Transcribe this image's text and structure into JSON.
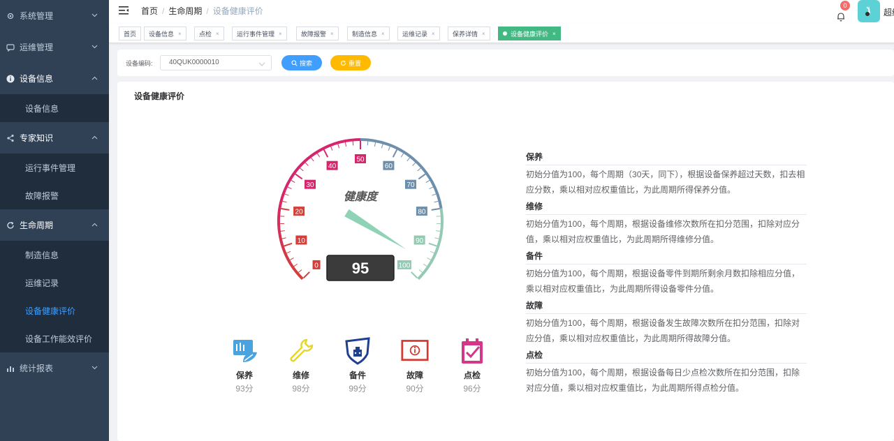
{
  "sidebar": {
    "items": [
      {
        "label": "系统管理",
        "icon": "gear-icon",
        "open": false
      },
      {
        "label": "运维管理",
        "icon": "chat-icon",
        "open": false
      },
      {
        "label": "设备信息",
        "icon": "info-icon",
        "open": true,
        "children": [
          "设备信息"
        ]
      },
      {
        "label": "专家知识",
        "icon": "share-icon",
        "open": true,
        "children": [
          "运行事件管理",
          "故障报警"
        ]
      },
      {
        "label": "生命周期",
        "icon": "refresh-icon",
        "open": true,
        "children": [
          "制造信息",
          "运维记录",
          "设备健康评价",
          "设备工作能效评价"
        ]
      },
      {
        "label": "统计报表",
        "icon": "bar-chart-icon",
        "open": false
      }
    ],
    "active_child": "设备健康评价"
  },
  "header": {
    "breadcrumb": [
      "首页",
      "生命周期",
      "设备健康评价"
    ],
    "badge_count": "0",
    "username": "超级"
  },
  "tags": [
    "首页",
    "设备信息",
    "点检",
    "运行事件管理",
    "故障报警",
    "制造信息",
    "运维记录",
    "保养详情",
    "设备健康评价"
  ],
  "active_tag": "设备健康评价",
  "search": {
    "label": "设备编码:",
    "value": "40QUK0000010",
    "search_btn": "搜索",
    "reset_btn": "重置"
  },
  "card": {
    "title": "设备健康评价"
  },
  "gauge": {
    "title": "健康度",
    "value": 95,
    "min": 0,
    "max": 100,
    "tick_labels": [
      "0",
      "10",
      "20",
      "30",
      "40",
      "50",
      "60",
      "70",
      "80",
      "90",
      "100"
    ],
    "colors": {
      "low": "#d43f3a",
      "mid": "#d6256d",
      "high": "#6e8fab",
      "top": "#94c9b4"
    }
  },
  "categories": [
    {
      "name": "保养",
      "score": "93分",
      "icon": "leaf-document-icon",
      "color": "#4aa3df"
    },
    {
      "name": "维修",
      "score": "98分",
      "icon": "wrench-icon",
      "color": "#e3d630"
    },
    {
      "name": "备件",
      "score": "99分",
      "icon": "parts-icon",
      "color": "#1f3f8f"
    },
    {
      "name": "故障",
      "score": "90分",
      "icon": "fault-icon",
      "color": "#d43a2f"
    },
    {
      "name": "点检",
      "score": "96分",
      "icon": "checklist-icon",
      "color": "#d43787"
    }
  ],
  "descriptions": [
    {
      "title": "保养",
      "text": "初始分值为100，每个周期（30天，同下），根据设备保养超过天数，扣去相应分数，乘以相对应权重值比，为此周期所得保养分值。"
    },
    {
      "title": "维修",
      "text": "初始分值为100，每个周期，根据设备维修次数所在扣分范围，扣除对应分值，乘以相对应权重值比，为此周期所得维修分值。"
    },
    {
      "title": "备件",
      "text": "初始分值为100，每个周期，根据设备零件到期所剩余月数扣除相应分值，乘以相对应权重值比，为此周期所得设备零件分值。"
    },
    {
      "title": "故障",
      "text": "初始分值为100，每个周期，根据设备发生故障次数所在扣分范围，扣除对应分值，乘以相对应权重值比，为此周期所得故障分值。"
    },
    {
      "title": "点检",
      "text": "初始分值为100，每个周期，根据设备每日少点检次数所在扣分范围，扣除对应分值，乘以相对应权重值比，为此周期所得点检分值。"
    }
  ]
}
